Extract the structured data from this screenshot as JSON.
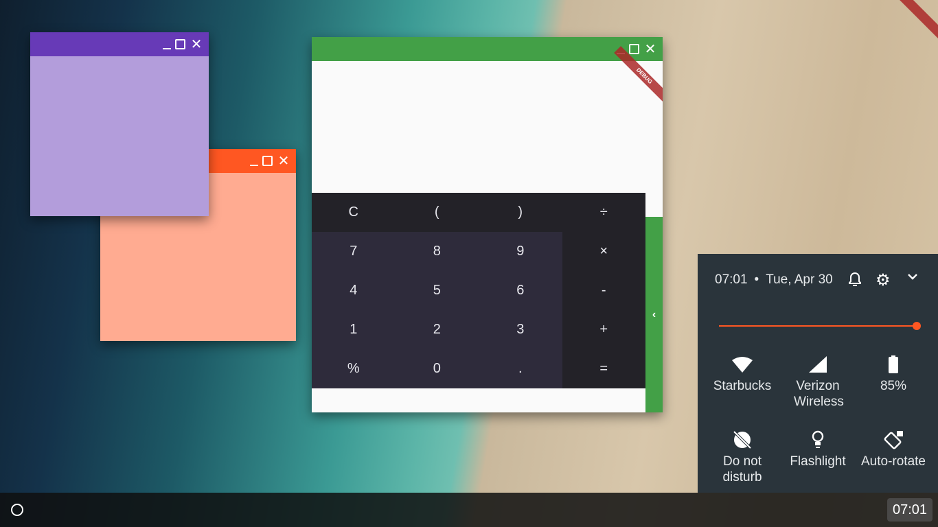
{
  "colors": {
    "purple_title": "#673ab7",
    "purple_body": "#b39ddb",
    "orange_title": "#ff5722",
    "orange_body": "#ffab91",
    "calc_title": "#43a047",
    "accent": "#ff5722"
  },
  "debug_banner": "DEBUG",
  "calculator": {
    "keys": [
      "C",
      "(",
      ")",
      "÷",
      "7",
      "8",
      "9",
      "×",
      "4",
      "5",
      "6",
      "-",
      "1",
      "2",
      "3",
      "+",
      "%",
      "0",
      ".",
      "="
    ]
  },
  "quick_settings": {
    "time": "07:01",
    "separator": "•",
    "date": "Tue, Apr 30",
    "brightness": 1.0,
    "tiles": [
      {
        "label": "Starbucks",
        "icon": "wifi-icon"
      },
      {
        "label": "Verizon Wireless",
        "icon": "signal-icon"
      },
      {
        "label": "85%",
        "icon": "battery-icon"
      },
      {
        "label": "Do not disturb",
        "icon": "do-not-disturb-icon"
      },
      {
        "label": "Flashlight",
        "icon": "flashlight-icon"
      },
      {
        "label": "Auto-rotate",
        "icon": "auto-rotate-icon"
      }
    ]
  },
  "taskbar": {
    "clock": "07:01"
  }
}
